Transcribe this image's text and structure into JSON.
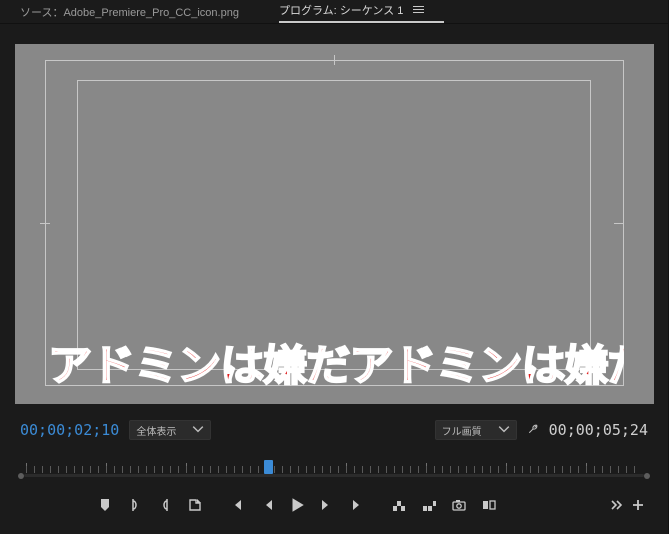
{
  "tabs": {
    "source_label": "ソース：Adobe_Premiere_Pro_CC_icon.png",
    "program_label": "プログラム: シーケンス 1"
  },
  "monitor": {
    "crawl_text": "アドミンは嫌だアドミンは嫌だ"
  },
  "status": {
    "timecode_current": "00;00;02;10",
    "fit_dropdown": "全体表示",
    "quality_dropdown": "フル画質",
    "timecode_total": "00;00;05;24"
  },
  "playhead_percent": 39.5,
  "icons": {
    "marker": "marker-icon",
    "in": "mark-in-icon",
    "out": "mark-out-icon",
    "export": "export-frame-icon",
    "goto_in": "go-to-in-icon",
    "step_back": "step-back-icon",
    "play": "play-icon",
    "step_fwd": "step-forward-icon",
    "goto_out": "go-to-out-icon",
    "lift": "lift-icon",
    "extract": "extract-icon",
    "camera": "camera-icon",
    "compare": "comparison-view-icon",
    "more": "more-icon",
    "add": "add-icon"
  }
}
